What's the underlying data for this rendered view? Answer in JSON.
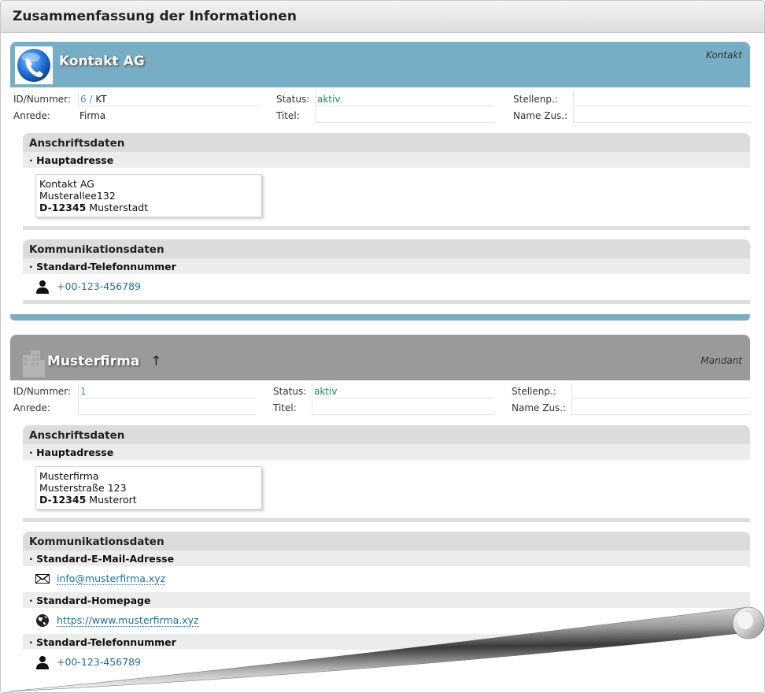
{
  "page": {
    "title": "Zusammenfassung der Informationen"
  },
  "cards": [
    {
      "name": "Kontakt AG",
      "kind": "Kontakt",
      "header_color": "#78adc6",
      "labels": {
        "id": "ID/Nummer:",
        "status": "Status:",
        "stellenp": "Stellenp.:",
        "anrede": "Anrede:",
        "titel": "Titel:",
        "namezus": "Name Zus.:"
      },
      "values": {
        "id_number": "6",
        "id_sep": "/",
        "id_code": "KT",
        "status": "aktiv",
        "stellenp": "",
        "anrede": "Firma",
        "titel": "",
        "namezus": ""
      },
      "address": {
        "section_title": "Anschriftsdaten",
        "sub_title": "· Hauptadresse",
        "line1": "Kontakt AG",
        "line2": "Musterallee132",
        "zip": "D-12345",
        "city": "Musterstadt"
      },
      "communication": {
        "section_title": "Kommunikationsdaten",
        "phone_title": "· Standard-Telefonnummer",
        "phone": "+00-123-456789"
      }
    },
    {
      "name": "Musterfirma",
      "name_suffix": "↑",
      "kind": "Mandant",
      "header_color": "#9a9a9a",
      "labels": {
        "id": "ID/Nummer:",
        "status": "Status:",
        "stellenp": "Stellenp.:",
        "anrede": "Anrede:",
        "titel": "Titel:",
        "namezus": "Name Zus.:"
      },
      "values": {
        "id_number": "1",
        "status": "aktiv",
        "stellenp": "",
        "anrede": "",
        "titel": "",
        "namezus": ""
      },
      "address": {
        "section_title": "Anschriftsdaten",
        "sub_title": "· Hauptadresse",
        "line1": "Musterfirma",
        "line2": "Musterstraße 123",
        "zip": "D-12345",
        "city": "Musterort"
      },
      "communication": {
        "section_title": "Kommunikationsdaten",
        "email_title": "· Standard-E-Mail-Adresse",
        "email": "info@musterfirma.xyz",
        "homepage_title": "· Standard-Homepage",
        "homepage": "https://www.musterfirma.xyz",
        "phone_title": "· Standard-Telefonnummer",
        "phone": "+00-123-456789"
      }
    }
  ],
  "icons": {
    "card1_logo": "phone-globe-icon",
    "card2_logo": "building-icon",
    "phone": "person-icon",
    "email": "envelope-icon",
    "homepage": "globe-icon"
  }
}
